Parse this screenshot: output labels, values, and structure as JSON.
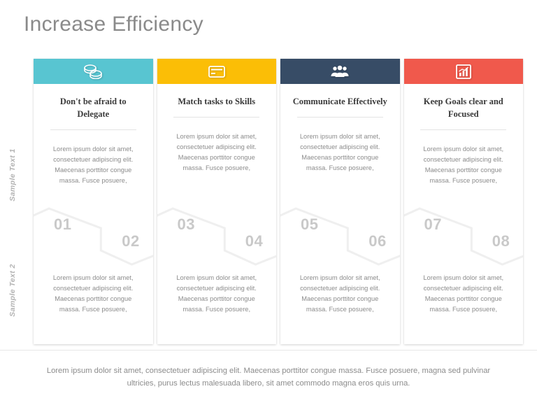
{
  "page": {
    "title": "Increase Efficiency",
    "background_color": "#ffffff",
    "title_color": "#8a8a8a"
  },
  "side_labels": {
    "label_1": "Sample Text 1",
    "label_2": "Sample Text 2"
  },
  "body_paragraph": "Lorem ipsum dolor sit amet, consectetuer adipiscing elit. Maecenas porttitor congue massa. Fusce posuere,",
  "columns": [
    {
      "title": "Don't be afraid to Delegate",
      "accent_color": "#58C5D1",
      "icon": "coins-icon",
      "number_odd": "01",
      "number_even": "02",
      "text_top": "Lorem ipsum dolor sit amet, consectetuer adipiscing elit. Maecenas porttitor congue massa. Fusce posuere,",
      "text_bottom": "Lorem ipsum dolor sit amet, consectetuer adipiscing elit. Maecenas porttitor congue massa. Fusce posuere,"
    },
    {
      "title": "Match tasks to Skills",
      "accent_color": "#FBBE06",
      "icon": "credit-card-icon",
      "number_odd": "03",
      "number_even": "04",
      "text_top": "Lorem ipsum dolor sit amet, consectetuer adipiscing elit. Maecenas porttitor congue massa. Fusce posuere,",
      "text_bottom": "Lorem ipsum dolor sit amet, consectetuer adipiscing elit. Maecenas porttitor congue massa. Fusce posuere,"
    },
    {
      "title": "Communicate Effectively",
      "accent_color": "#374C66",
      "icon": "users-group-icon",
      "number_odd": "05",
      "number_even": "06",
      "text_top": "Lorem ipsum dolor sit amet, consectetuer adipiscing elit. Maecenas porttitor congue massa. Fusce posuere,",
      "text_bottom": "Lorem ipsum dolor sit amet, consectetuer adipiscing elit. Maecenas porttitor congue massa. Fusce posuere,"
    },
    {
      "title": "Keep Goals clear and Focused",
      "accent_color": "#F0594C",
      "icon": "bar-chart-growth-icon",
      "number_odd": "07",
      "number_even": "08",
      "text_top": "Lorem ipsum dolor sit amet, consectetuer adipiscing elit. Maecenas porttitor congue massa. Fusce posuere,",
      "text_bottom": "Lorem ipsum dolor sit amet, consectetuer adipiscing elit. Maecenas porttitor congue massa. Fusce posuere,"
    }
  ],
  "footer": {
    "text": "Lorem ipsum dolor sit amet, consectetuer adipiscing elit. Maecenas porttitor congue massa. Fusce posuere, magna sed pulvinar ultricies, purus lectus malesuada libero, sit amet commodo magna eros quis urna."
  }
}
